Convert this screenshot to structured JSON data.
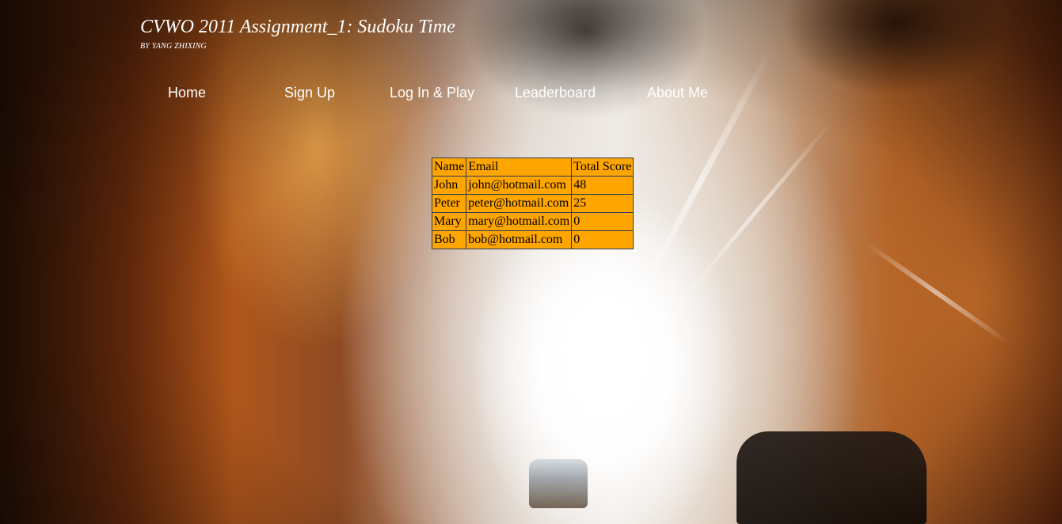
{
  "header": {
    "title": "CVWO 2011 Assignment_1: Sudoku Time",
    "byline": "BY YANG ZHIXING"
  },
  "nav": {
    "items": [
      {
        "label": "Home"
      },
      {
        "label": "Sign Up"
      },
      {
        "label": "Log In & Play"
      },
      {
        "label": "Leaderboard"
      },
      {
        "label": "About Me"
      }
    ]
  },
  "leaderboard": {
    "columns": [
      "Name",
      "Email",
      "Total Score"
    ],
    "rows": [
      [
        "John",
        "john@hotmail.com",
        "48"
      ],
      [
        "Peter",
        "peter@hotmail.com",
        "25"
      ],
      [
        "Mary",
        "mary@hotmail.com",
        "0"
      ],
      [
        "Bob",
        "bob@hotmail.com",
        "0"
      ]
    ]
  },
  "colors": {
    "table_background": "#ffa500",
    "table_border": "#2b3a55",
    "text_light": "#ffffff"
  }
}
